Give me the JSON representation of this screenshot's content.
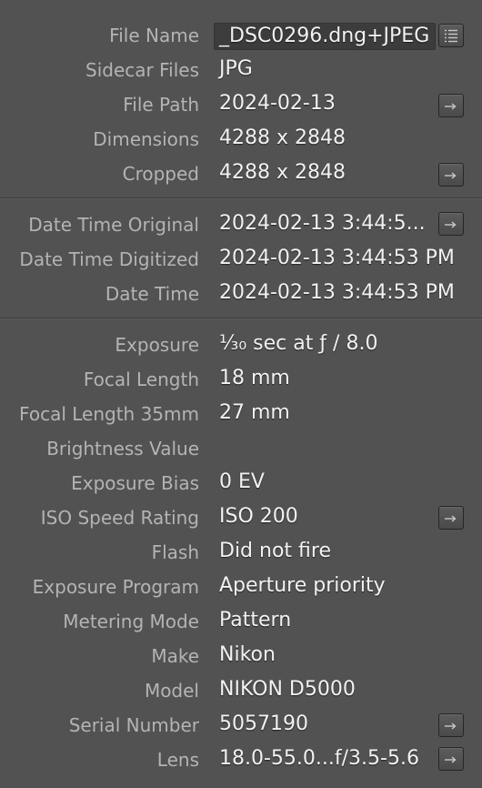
{
  "metadata": {
    "file_name": {
      "label": "File Name",
      "value": "_DSC0296.dng+JPEG"
    },
    "sidecar_files": {
      "label": "Sidecar Files",
      "value": "JPG"
    },
    "file_path": {
      "label": "File Path",
      "value": "2024-02-13"
    },
    "dimensions": {
      "label": "Dimensions",
      "value": "4288 x 2848"
    },
    "cropped": {
      "label": "Cropped",
      "value": "4288 x 2848"
    },
    "date_time_original": {
      "label": "Date Time Original",
      "value": "2024-02-13 3:44:5..."
    },
    "date_time_digitized": {
      "label": "Date Time Digitized",
      "value": "2024-02-13 3:44:53 PM"
    },
    "date_time": {
      "label": "Date Time",
      "value": "2024-02-13 3:44:53 PM"
    },
    "exposure": {
      "label": "Exposure",
      "value": "⅟₃₀ sec at ƒ / 8.0"
    },
    "focal_length": {
      "label": "Focal Length",
      "value": "18 mm"
    },
    "focal_length_35mm": {
      "label": "Focal Length 35mm",
      "value": "27 mm"
    },
    "brightness_value": {
      "label": "Brightness Value",
      "value": ""
    },
    "exposure_bias": {
      "label": "Exposure Bias",
      "value": "0 EV"
    },
    "iso_speed_rating": {
      "label": "ISO Speed Rating",
      "value": "ISO 200"
    },
    "flash": {
      "label": "Flash",
      "value": "Did not fire"
    },
    "exposure_program": {
      "label": "Exposure Program",
      "value": "Aperture priority"
    },
    "metering_mode": {
      "label": "Metering Mode",
      "value": "Pattern"
    },
    "make": {
      "label": "Make",
      "value": "Nikon"
    },
    "model": {
      "label": "Model",
      "value": "NIKON D5000"
    },
    "serial_number": {
      "label": "Serial Number",
      "value": "5057190"
    },
    "lens": {
      "label": "Lens",
      "value": "18.0-55.0...f/3.5-5.6"
    }
  },
  "icons": {
    "list": "list-icon",
    "goto": "go-to-arrow-icon"
  },
  "colors": {
    "background": "#525252",
    "label": "#b4b4b4",
    "value": "#f2f2f2"
  }
}
